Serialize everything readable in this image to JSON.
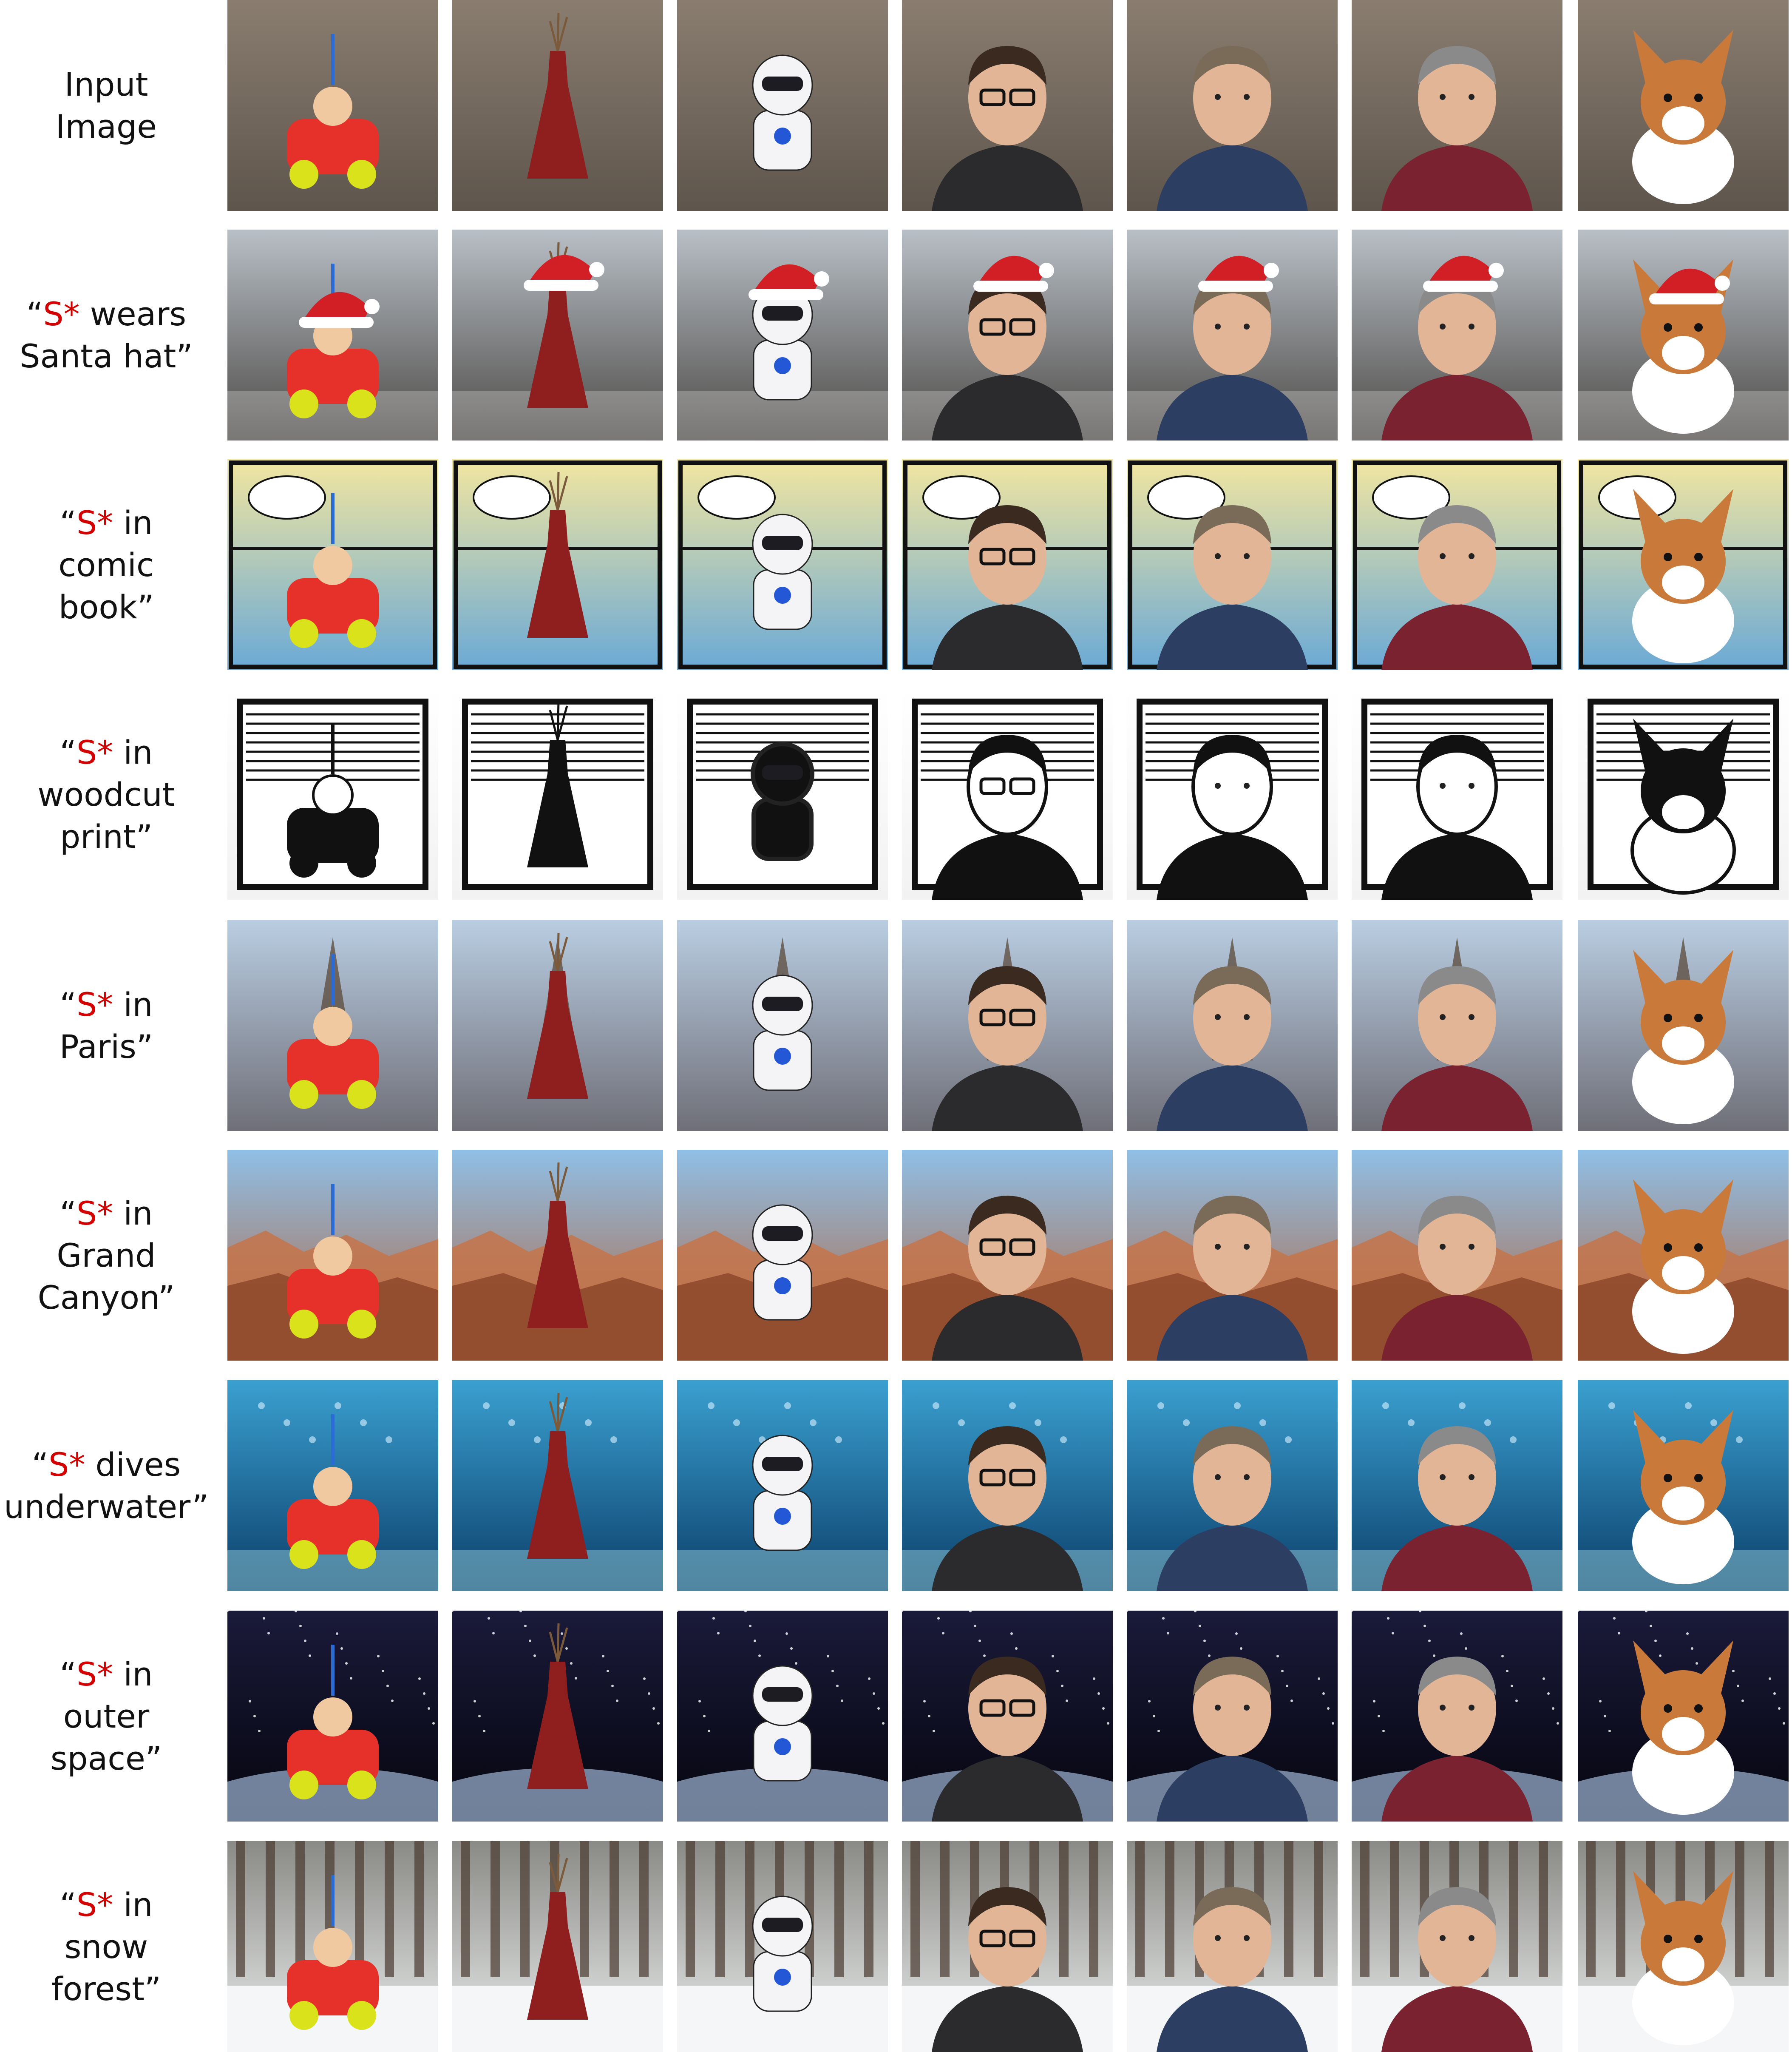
{
  "rows": [
    {
      "lines": [
        {
          "pre": "",
          "s": "",
          "post": "Input"
        },
        {
          "pre": "",
          "s": "",
          "post": "Image"
        }
      ]
    },
    {
      "lines": [
        {
          "pre": "“",
          "s": "S*",
          "post": " wears"
        },
        {
          "pre": "",
          "s": "",
          "post": "Santa hat”"
        }
      ]
    },
    {
      "lines": [
        {
          "pre": "“",
          "s": "S*",
          "post": " in"
        },
        {
          "pre": "",
          "s": "",
          "post": "comic"
        },
        {
          "pre": "",
          "s": "",
          "post": "book”"
        }
      ]
    },
    {
      "lines": [
        {
          "pre": "“",
          "s": "S*",
          "post": " in"
        },
        {
          "pre": "",
          "s": "",
          "post": "woodcut"
        },
        {
          "pre": "",
          "s": "",
          "post": "print”"
        }
      ]
    },
    {
      "lines": [
        {
          "pre": "“",
          "s": "S*",
          "post": " in"
        },
        {
          "pre": "",
          "s": "",
          "post": "Paris”"
        }
      ]
    },
    {
      "lines": [
        {
          "pre": "“",
          "s": "S*",
          "post": " in"
        },
        {
          "pre": "",
          "s": "",
          "post": "Grand"
        },
        {
          "pre": "",
          "s": "",
          "post": "Canyon”"
        }
      ]
    },
    {
      "lines": [
        {
          "pre": "“",
          "s": "S*",
          "post": " dives"
        },
        {
          "pre": "",
          "s": "",
          "post": "underwater”"
        }
      ]
    },
    {
      "lines": [
        {
          "pre": "“",
          "s": "S*",
          "post": " in"
        },
        {
          "pre": "",
          "s": "",
          "post": "outer"
        },
        {
          "pre": "",
          "s": "",
          "post": "space”"
        }
      ]
    },
    {
      "lines": [
        {
          "pre": "“",
          "s": "S*",
          "post": " in"
        },
        {
          "pre": "",
          "s": "",
          "post": "snow"
        },
        {
          "pre": "",
          "s": "",
          "post": "forest”"
        }
      ]
    }
  ],
  "row_scenes": [
    "input",
    "santa",
    "comic",
    "woodcut",
    "paris",
    "canyon",
    "underwater",
    "space",
    "snow"
  ],
  "subjects": [
    "toy-car",
    "red-vase",
    "robot-toy",
    "man-glasses",
    "man-grey-sweater",
    "man-curly-hair",
    "corgi-puppy"
  ],
  "colors": {
    "label_text": "#111111",
    "s_star": "#d40000"
  }
}
